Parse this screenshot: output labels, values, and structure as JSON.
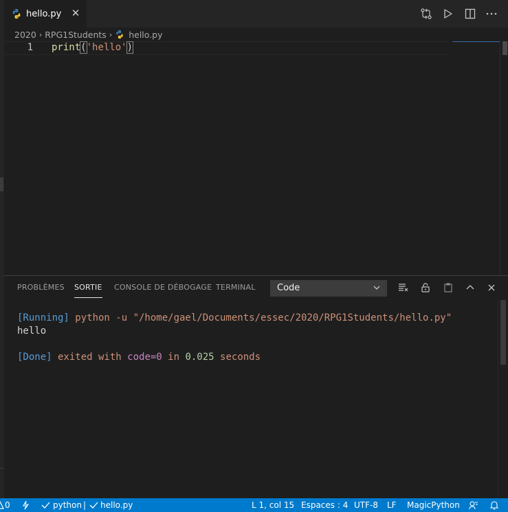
{
  "tab": {
    "filename": "hello.py"
  },
  "breadcrumb": {
    "parts": [
      "2020",
      "RPG1Students",
      "hello.py"
    ]
  },
  "editor": {
    "line_number": "1",
    "code": {
      "fn": "print",
      "open": "(",
      "arg": "'hello'",
      "close": ")"
    }
  },
  "panel": {
    "tabs": [
      "PROBLÈMES",
      "SORTIE",
      "CONSOLE DE DÉBOGAGE",
      "TERMINAL"
    ],
    "active_tab": "SORTIE",
    "select_value": "Code",
    "output": {
      "line1": {
        "tag": "[Running]",
        "cmd": " python -u \"/home/gael/Documents/essec/2020/RPG1Students/hello.py\""
      },
      "line2": "hello",
      "line3": {
        "tag": "[Done]",
        "p1": " exited with ",
        "kw": "code=0",
        "p2": " in ",
        "num": "0.025",
        "p3": " seconds"
      }
    }
  },
  "statusbar": {
    "count": "0",
    "python": "python",
    "separator": "|",
    "file": "hello.py",
    "position": "L 1, col 15",
    "spaces": "Espaces : 4",
    "encoding": "UTF-8",
    "eol": "LF",
    "language": "MagicPython"
  },
  "colors": {
    "statusbar": "#007acc",
    "editor_bg": "#1e1e1e",
    "tab_bar": "#252526"
  },
  "icons": [
    "python-icon",
    "close-icon",
    "open-changes-icon",
    "run-icon",
    "split-editor-icon",
    "more-actions-icon",
    "clear-output-icon",
    "lock-scroll-icon",
    "open-log-icon",
    "maximize-panel-icon",
    "close-panel-icon",
    "chevron-down-icon",
    "sync-icon",
    "check-icon",
    "feedback-icon",
    "bell-icon"
  ]
}
